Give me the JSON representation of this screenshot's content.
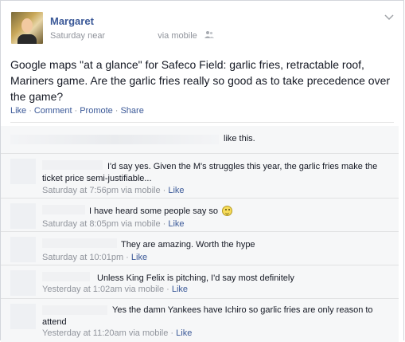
{
  "post": {
    "author": "Margaret",
    "time": "Saturday near",
    "via": "via mobile",
    "audience_icon": "friends-icon",
    "text": "Google maps \"at a glance\" for Safeco Field: garlic fries, retractable roof, Mariners game. Are the garlic fries really so good as to take precedence over the game?",
    "actions": {
      "like": "Like",
      "comment": "Comment",
      "promote": "Promote",
      "share": "Share",
      "separator": "·"
    },
    "likes_text": "like this."
  },
  "comments": [
    {
      "text": "I'd say yes. Given the M's struggles this year, the garlic fries make the ticket price semi-justifiable...",
      "time": "Saturday at 7:56pm via mobile",
      "like": "Like"
    },
    {
      "text": "I have heard some people say so",
      "time": "Saturday at 8:05pm via mobile",
      "like": "Like",
      "emoticon": "smiley-icon"
    },
    {
      "text": "They are amazing. Worth the hype",
      "time": "Saturday at 10:01pm",
      "like": "Like"
    },
    {
      "text": "Unless King Felix is pitching, I'd say most definitely",
      "time": "Yesterday at 1:02am via mobile",
      "like": "Like"
    },
    {
      "text": "Yes the damn Yankees have Ichiro so garlic fries are only reason to attend",
      "time": "Yesterday at 11:20am via mobile",
      "like": "Like"
    }
  ]
}
